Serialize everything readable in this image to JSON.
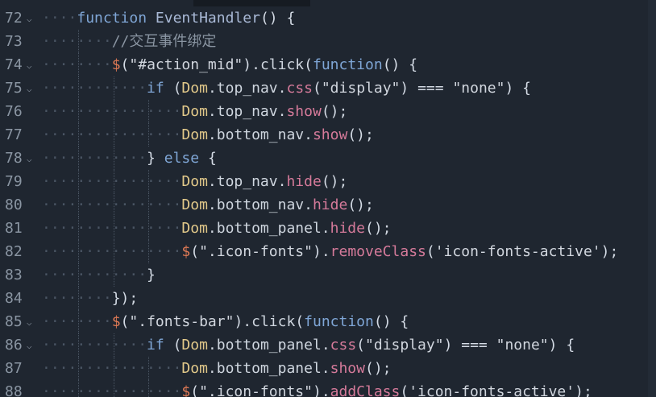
{
  "editor": {
    "colors": {
      "background": "#1f2630",
      "line_number": "#8a95a2",
      "keyword": "#7fa6d6",
      "jquery_dollar": "#e07a55",
      "object": "#e2c98a",
      "method": "#d57a9a",
      "string": "#d1d6de",
      "comment": "#8a95a2",
      "plain": "#cfd6df"
    },
    "lines": [
      {
        "num": "72",
        "fold": "v",
        "indent": 1,
        "tokens": [
          {
            "t": "kw",
            "v": "function"
          },
          {
            "t": "plain",
            "v": " "
          },
          {
            "t": "fn",
            "v": "EventHandler"
          },
          {
            "t": "paren",
            "v": "()"
          },
          {
            "t": "plain",
            "v": " "
          },
          {
            "t": "brace",
            "v": "{"
          }
        ]
      },
      {
        "num": "73",
        "fold": "",
        "indent": 2,
        "tokens": [
          {
            "t": "comment",
            "v": "//交互事件绑定"
          }
        ]
      },
      {
        "num": "74",
        "fold": "v",
        "indent": 2,
        "tokens": [
          {
            "t": "dollar",
            "v": "$"
          },
          {
            "t": "paren",
            "v": "("
          },
          {
            "t": "str",
            "v": "\"#action_mid\""
          },
          {
            "t": "paren",
            "v": ")"
          },
          {
            "t": "plain",
            "v": ".click"
          },
          {
            "t": "paren",
            "v": "("
          },
          {
            "t": "kw",
            "v": "function"
          },
          {
            "t": "paren",
            "v": "()"
          },
          {
            "t": "plain",
            "v": " "
          },
          {
            "t": "brace",
            "v": "{"
          }
        ]
      },
      {
        "num": "75",
        "fold": "v",
        "indent": 3,
        "tokens": [
          {
            "t": "kw",
            "v": "if"
          },
          {
            "t": "plain",
            "v": " "
          },
          {
            "t": "paren",
            "v": "("
          },
          {
            "t": "obj",
            "v": "Dom"
          },
          {
            "t": "plain",
            "v": ".top_nav."
          },
          {
            "t": "method",
            "v": "css"
          },
          {
            "t": "paren",
            "v": "("
          },
          {
            "t": "str",
            "v": "\"display\""
          },
          {
            "t": "paren",
            "v": ")"
          },
          {
            "t": "plain",
            "v": " "
          },
          {
            "t": "op",
            "v": "==="
          },
          {
            "t": "plain",
            "v": " "
          },
          {
            "t": "str",
            "v": "\"none\""
          },
          {
            "t": "paren",
            "v": ")"
          },
          {
            "t": "plain",
            "v": " "
          },
          {
            "t": "brace",
            "v": "{"
          }
        ]
      },
      {
        "num": "76",
        "fold": "",
        "indent": 4,
        "tokens": [
          {
            "t": "obj",
            "v": "Dom"
          },
          {
            "t": "plain",
            "v": ".top_nav."
          },
          {
            "t": "method",
            "v": "show"
          },
          {
            "t": "paren",
            "v": "()"
          },
          {
            "t": "plain",
            "v": ";"
          }
        ]
      },
      {
        "num": "77",
        "fold": "",
        "indent": 4,
        "tokens": [
          {
            "t": "obj",
            "v": "Dom"
          },
          {
            "t": "plain",
            "v": ".bottom_nav."
          },
          {
            "t": "method",
            "v": "show"
          },
          {
            "t": "paren",
            "v": "()"
          },
          {
            "t": "plain",
            "v": ";"
          }
        ]
      },
      {
        "num": "78",
        "fold": "v",
        "indent": 3,
        "tokens": [
          {
            "t": "brace",
            "v": "}"
          },
          {
            "t": "plain",
            "v": " "
          },
          {
            "t": "kw",
            "v": "else"
          },
          {
            "t": "plain",
            "v": " "
          },
          {
            "t": "brace",
            "v": "{"
          }
        ]
      },
      {
        "num": "79",
        "fold": "",
        "indent": 4,
        "tokens": [
          {
            "t": "obj",
            "v": "Dom"
          },
          {
            "t": "plain",
            "v": ".top_nav."
          },
          {
            "t": "method",
            "v": "hide"
          },
          {
            "t": "paren",
            "v": "()"
          },
          {
            "t": "plain",
            "v": ";"
          }
        ]
      },
      {
        "num": "80",
        "fold": "",
        "indent": 4,
        "tokens": [
          {
            "t": "obj",
            "v": "Dom"
          },
          {
            "t": "plain",
            "v": ".bottom_nav."
          },
          {
            "t": "method",
            "v": "hide"
          },
          {
            "t": "paren",
            "v": "()"
          },
          {
            "t": "plain",
            "v": ";"
          }
        ]
      },
      {
        "num": "81",
        "fold": "",
        "indent": 4,
        "tokens": [
          {
            "t": "obj",
            "v": "Dom"
          },
          {
            "t": "plain",
            "v": ".bottom_panel."
          },
          {
            "t": "method",
            "v": "hide"
          },
          {
            "t": "paren",
            "v": "()"
          },
          {
            "t": "plain",
            "v": ";"
          }
        ]
      },
      {
        "num": "82",
        "fold": "",
        "indent": 4,
        "tokens": [
          {
            "t": "dollar",
            "v": "$"
          },
          {
            "t": "paren",
            "v": "("
          },
          {
            "t": "str",
            "v": "\".icon-fonts\""
          },
          {
            "t": "paren",
            "v": ")"
          },
          {
            "t": "plain",
            "v": "."
          },
          {
            "t": "method",
            "v": "removeClass"
          },
          {
            "t": "paren",
            "v": "("
          },
          {
            "t": "str",
            "v": "'icon-fonts-active'"
          },
          {
            "t": "paren",
            "v": ")"
          },
          {
            "t": "plain",
            "v": ";"
          }
        ]
      },
      {
        "num": "83",
        "fold": "",
        "indent": 3,
        "tokens": [
          {
            "t": "brace",
            "v": "}"
          }
        ]
      },
      {
        "num": "84",
        "fold": "",
        "indent": 2,
        "tokens": [
          {
            "t": "brace",
            "v": "}"
          },
          {
            "t": "paren",
            "v": ")"
          },
          {
            "t": "plain",
            "v": ";"
          }
        ]
      },
      {
        "num": "85",
        "fold": "v",
        "indent": 2,
        "tokens": [
          {
            "t": "dollar",
            "v": "$"
          },
          {
            "t": "paren",
            "v": "("
          },
          {
            "t": "str",
            "v": "\".fonts-bar\""
          },
          {
            "t": "paren",
            "v": ")"
          },
          {
            "t": "plain",
            "v": ".click"
          },
          {
            "t": "paren",
            "v": "("
          },
          {
            "t": "kw",
            "v": "function"
          },
          {
            "t": "paren",
            "v": "()"
          },
          {
            "t": "plain",
            "v": " "
          },
          {
            "t": "brace",
            "v": "{"
          }
        ]
      },
      {
        "num": "86",
        "fold": "v",
        "indent": 3,
        "tokens": [
          {
            "t": "kw",
            "v": "if"
          },
          {
            "t": "plain",
            "v": " "
          },
          {
            "t": "paren",
            "v": "("
          },
          {
            "t": "obj",
            "v": "Dom"
          },
          {
            "t": "plain",
            "v": ".bottom_panel."
          },
          {
            "t": "method",
            "v": "css"
          },
          {
            "t": "paren",
            "v": "("
          },
          {
            "t": "str",
            "v": "\"display\""
          },
          {
            "t": "paren",
            "v": ")"
          },
          {
            "t": "plain",
            "v": " "
          },
          {
            "t": "op",
            "v": "==="
          },
          {
            "t": "plain",
            "v": " "
          },
          {
            "t": "str",
            "v": "\"none\""
          },
          {
            "t": "paren",
            "v": ")"
          },
          {
            "t": "plain",
            "v": " "
          },
          {
            "t": "brace",
            "v": "{"
          }
        ]
      },
      {
        "num": "87",
        "fold": "",
        "indent": 4,
        "tokens": [
          {
            "t": "obj",
            "v": "Dom"
          },
          {
            "t": "plain",
            "v": ".bottom_panel."
          },
          {
            "t": "method",
            "v": "show"
          },
          {
            "t": "paren",
            "v": "()"
          },
          {
            "t": "plain",
            "v": ";"
          }
        ]
      },
      {
        "num": "88",
        "fold": "",
        "indent": 4,
        "tokens": [
          {
            "t": "dollar",
            "v": "$"
          },
          {
            "t": "paren",
            "v": "("
          },
          {
            "t": "str",
            "v": "\".icon-fonts\""
          },
          {
            "t": "paren",
            "v": ")"
          },
          {
            "t": "plain",
            "v": "."
          },
          {
            "t": "method",
            "v": "addClass"
          },
          {
            "t": "paren",
            "v": "("
          },
          {
            "t": "str",
            "v": "'icon-fonts-active'"
          },
          {
            "t": "paren",
            "v": ")"
          },
          {
            "t": "plain",
            "v": ";"
          }
        ]
      }
    ]
  }
}
